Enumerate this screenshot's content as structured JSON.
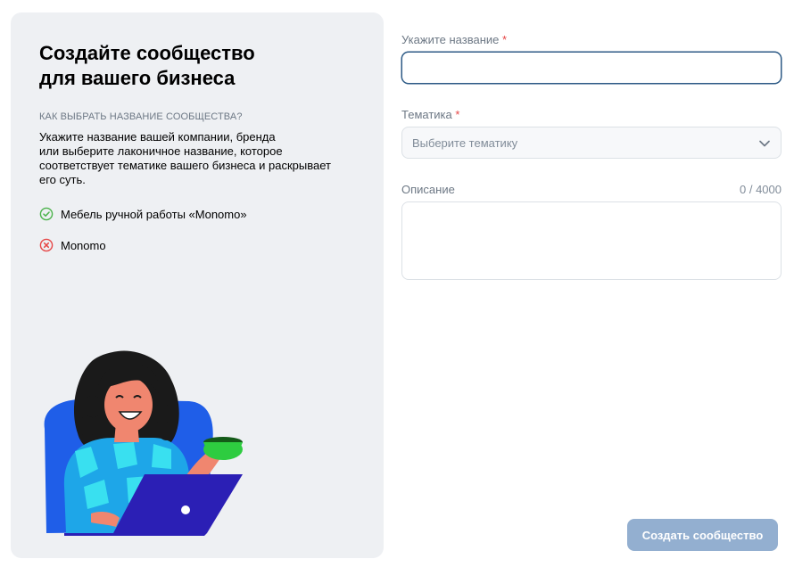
{
  "left_panel": {
    "title_line1": "Создайте сообщество",
    "title_line2": "для вашего бизнеса",
    "hint_caption": "КАК ВЫБРАТЬ НАЗВАНИЕ СООБЩЕСТВА?",
    "hint_line1": "Укажите название вашей компании, бренда",
    "hint_line2": "или выберите лаконичное название, которое",
    "hint_line3": "соответствует тематике вашего бизнеса и раскрывает",
    "hint_line4": "его суть.",
    "good_example": "Мебель ручной работы «Monomo»",
    "bad_example": "Monomo",
    "icons": {
      "good": "check-circle-icon",
      "bad": "cross-circle-icon"
    }
  },
  "form": {
    "name": {
      "label": "Укажите название",
      "required_mark": "*",
      "value": ""
    },
    "topic": {
      "label": "Тематика",
      "required_mark": "*",
      "placeholder": "Выберите тематику"
    },
    "description": {
      "label": "Описание",
      "counter": "0 / 4000",
      "value": ""
    },
    "submit_label": "Создать сообщество"
  },
  "colors": {
    "accent": "#2d5a86",
    "success": "#4bb34b",
    "error": "#e64646",
    "button_disabled": "#93afd0",
    "panel_bg": "#eef0f3"
  }
}
